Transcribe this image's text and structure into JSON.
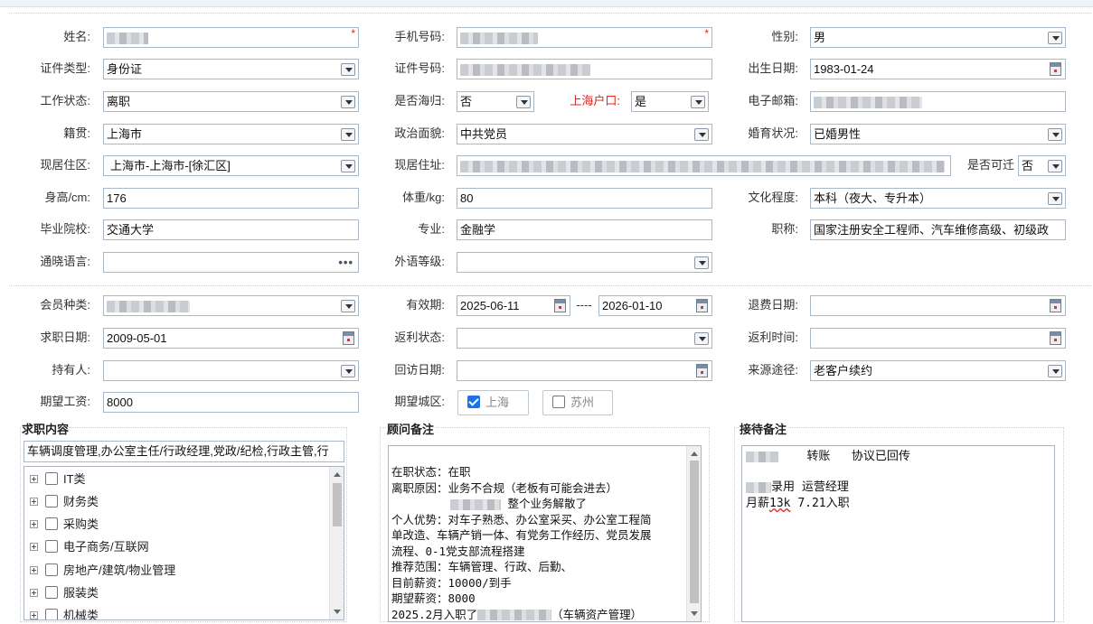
{
  "row1": {
    "name_label": "姓名:",
    "phone_label": "手机号码:",
    "gender_label": "性别:",
    "gender_value": "男",
    "required_mark": "*"
  },
  "row2": {
    "id_type_label": "证件类型:",
    "id_type_value": "身份证",
    "id_no_label": "证件号码:",
    "birth_label": "出生日期:",
    "birth_value": "1983-01-24"
  },
  "row3": {
    "work_status_label": "工作状态:",
    "work_status_value": "离职",
    "returnee_label": "是否海归:",
    "returnee_value": "否",
    "hukou_label": "上海户口:",
    "hukou_value": "是",
    "email_label": "电子邮箱:"
  },
  "row4": {
    "native_label": "籍贯:",
    "native_value": "上海市",
    "politics_label": "政治面貌:",
    "politics_value": "中共党员",
    "marital_label": "婚育状况:",
    "marital_value": "已婚男性"
  },
  "row5": {
    "residence_area_label": "现居住区:",
    "residence_area_value": "上海市-上海市-[徐汇区]",
    "address_label": "现居住址:",
    "relocate_label": "是否可迁",
    "relocate_value": "否"
  },
  "row6": {
    "height_label": "身高/cm:",
    "height_value": "176",
    "weight_label": "体重/kg:",
    "weight_value": "80",
    "education_label": "文化程度:",
    "education_value": "本科（夜大、专升本）"
  },
  "row7": {
    "school_label": "毕业院校:",
    "school_value": "交通大学",
    "major_label": "专业:",
    "major_value": "金融学",
    "title_label": "职称:",
    "title_value": "国家注册安全工程师、汽车维修高级、初级政"
  },
  "row8": {
    "language_label": "通晓语言:",
    "language_button": "•••",
    "foreign_level_label": "外语等级:"
  },
  "member": {
    "type_label": "会员种类:",
    "validity_label": "有效期:",
    "validity_start": "2025-06-11",
    "validity_sep": "----",
    "validity_end": "2026-01-10",
    "refund_date_label": "退费日期:",
    "job_date_label": "求职日期:",
    "job_date_value": "2009-05-01",
    "rebate_status_label": "返利状态:",
    "rebate_time_label": "返利时间:",
    "holder_label": "持有人:",
    "visit_date_label": "回访日期:",
    "source_label": "来源途径:",
    "source_value": "老客户续约",
    "salary_label": "期望工资:",
    "salary_value": "8000",
    "city_label": "期望城区:",
    "cities": [
      {
        "label": "上海",
        "checked": true
      },
      {
        "label": "苏州",
        "checked": false
      }
    ]
  },
  "job_content": {
    "title": "求职内容",
    "summary": "车辆调度管理,办公室主任/行政经理,党政/纪检,行政主管,行",
    "categories": [
      "IT类",
      "财务类",
      "采购类",
      "电子商务/互联网",
      "房地产/建筑/物业管理",
      "服装类",
      "机械类"
    ]
  },
  "consultant": {
    "title": "顾问备注",
    "lines": [
      "在职状态：在职",
      "离职原因：业务不合规（老板有可能会进去）",
      "整个业务解散了",
      "个人优势：对车子熟悉、办公室采买、办公室工程简",
      "单改造、车辆产销一体、有党务工作经历、党员发展",
      "流程、0-1党支部流程搭建",
      "推荐范围：车辆管理、行政、后勤、",
      "目前薪资：10000/到手",
      "期望薪资：8000",
      "2025.2月入职了",
      "（车辆资产管理）"
    ]
  },
  "reception": {
    "title": "接待备注",
    "line1_a": "转账",
    "line1_b": "协议已回传",
    "line2": "录用 运营经理",
    "line3_a": "月薪",
    "line3_b": "13k",
    "line3_c": " 7.21入职"
  }
}
